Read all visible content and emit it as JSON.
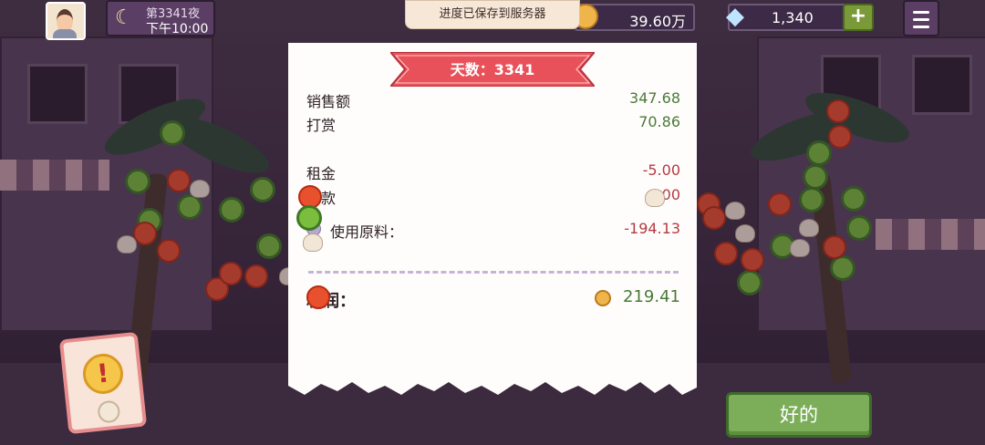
{
  "top_bar": {
    "night_label": "第3341夜",
    "time": "下午10:00",
    "toast": "进度已保存到服务器",
    "coins": "39.60万",
    "gems": "1,340",
    "plus": "+"
  },
  "receipt": {
    "banner": "天数：3341",
    "rows": [
      {
        "label": "销售额",
        "value": "347.68"
      },
      {
        "label": "打赏",
        "value": "70.86"
      },
      {
        "label": "租金",
        "value": "-5.00"
      },
      {
        "label": "贷款",
        "value": ".00"
      },
      {
        "label": "使用原料：",
        "value": "-194.13"
      }
    ],
    "profit_label": "利润：",
    "profit_value": "219.41"
  },
  "ok_button": "好的",
  "alert_icon": "!",
  "colors": {
    "positive": "#4a7a3a",
    "negative": "#b43a44",
    "banner": "#e8515a",
    "ok_button": "#7cae5a"
  },
  "icons": [
    "moon-icon",
    "coin-icon",
    "gem-icon",
    "menu-icon",
    "alert-icon"
  ]
}
